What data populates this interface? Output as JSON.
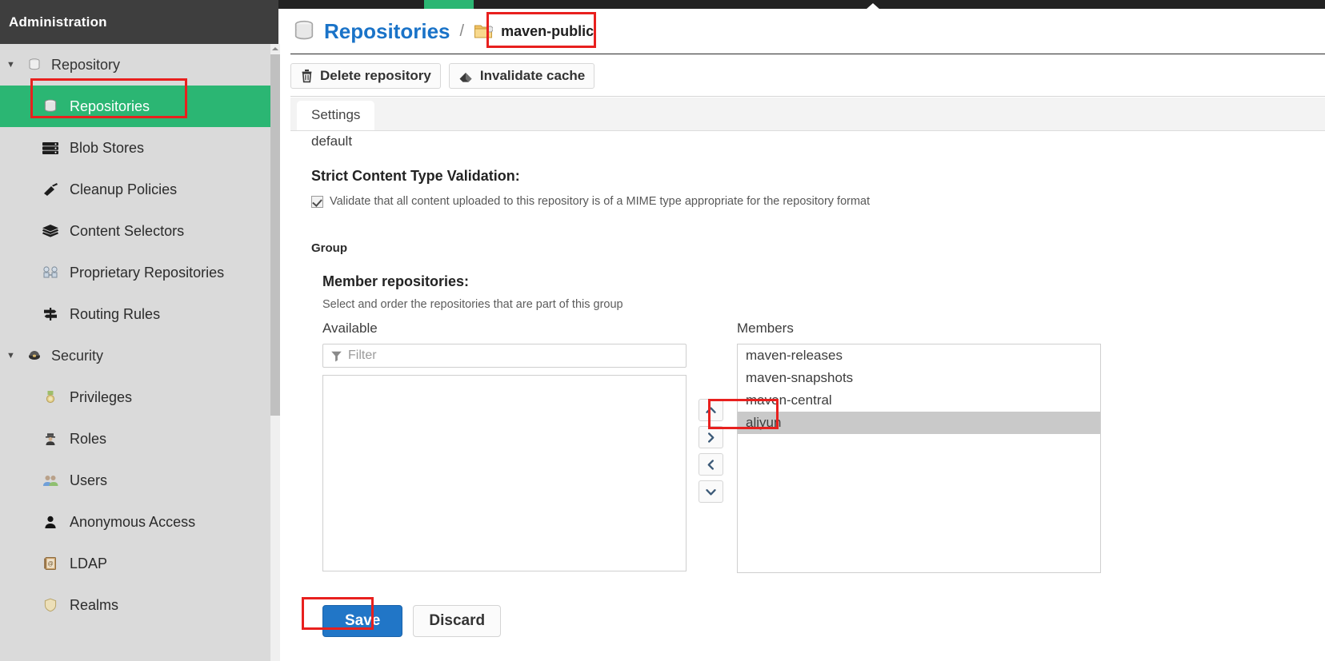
{
  "app": {
    "admin_title": "Administration"
  },
  "sidebar": {
    "groups": [
      {
        "label": "Repository",
        "icon": "database-icon",
        "expanded": true,
        "items": [
          {
            "label": "Repositories",
            "icon": "database-icon",
            "active": true
          },
          {
            "label": "Blob Stores",
            "icon": "server-icon",
            "active": false
          },
          {
            "label": "Cleanup Policies",
            "icon": "broom-icon",
            "active": false
          },
          {
            "label": "Content Selectors",
            "icon": "layers-icon",
            "active": false
          },
          {
            "label": "Proprietary Repositories",
            "icon": "proprietary-icon",
            "active": false
          },
          {
            "label": "Routing Rules",
            "icon": "signpost-icon",
            "active": false
          }
        ]
      },
      {
        "label": "Security",
        "icon": "shield-badge-icon",
        "expanded": true,
        "items": [
          {
            "label": "Privileges",
            "icon": "medal-icon",
            "active": false
          },
          {
            "label": "Roles",
            "icon": "officer-icon",
            "active": false
          },
          {
            "label": "Users",
            "icon": "users-icon",
            "active": false
          },
          {
            "label": "Anonymous Access",
            "icon": "person-icon",
            "active": false
          },
          {
            "label": "LDAP",
            "icon": "address-book-icon",
            "active": false
          },
          {
            "label": "Realms",
            "icon": "shield-icon",
            "active": false
          }
        ]
      }
    ]
  },
  "breadcrumb": {
    "root_label": "Repositories",
    "separator": "/",
    "current_label": "maven-public",
    "root_icon": "database-icon",
    "current_icon": "folder-icon"
  },
  "toolbar": {
    "delete_label": "Delete repository",
    "delete_icon": "trash-icon",
    "invalidate_label": "Invalidate cache",
    "invalidate_icon": "eraser-icon"
  },
  "tabs": [
    {
      "label": "Settings",
      "active": true
    }
  ],
  "form": {
    "default_value": "default",
    "strict_label": "Strict Content Type Validation:",
    "strict_checkbox_label": "Validate that all content uploaded to this repository is of a MIME type appropriate for the repository format",
    "strict_checked": true,
    "group_section_label": "Group",
    "member_repos_label": "Member repositories:",
    "member_repos_hint": "Select and order the repositories that are part of this group",
    "available_label": "Available",
    "members_label": "Members",
    "filter_placeholder": "Filter",
    "filter_value": "",
    "filter_icon": "funnel-icon",
    "available_items": [],
    "members_items": [
      {
        "label": "maven-releases",
        "selected": false
      },
      {
        "label": "maven-snapshots",
        "selected": false
      },
      {
        "label": "maven-central",
        "selected": false
      },
      {
        "label": "aliyun",
        "selected": true
      }
    ],
    "arrows": [
      {
        "name": "move-up-button",
        "glyph": "up"
      },
      {
        "name": "move-right-button",
        "glyph": "right"
      },
      {
        "name": "move-left-button",
        "glyph": "left"
      },
      {
        "name": "move-down-button",
        "glyph": "down"
      }
    ]
  },
  "footer": {
    "save_label": "Save",
    "discard_label": "Discard"
  },
  "colors": {
    "accent_green": "#2bb673",
    "link_blue": "#1a73c8",
    "save_blue": "#2176c7",
    "admin_bar": "#3e3e3e",
    "sidebar_bg": "#dadada",
    "highlight_red": "#e8201e"
  }
}
